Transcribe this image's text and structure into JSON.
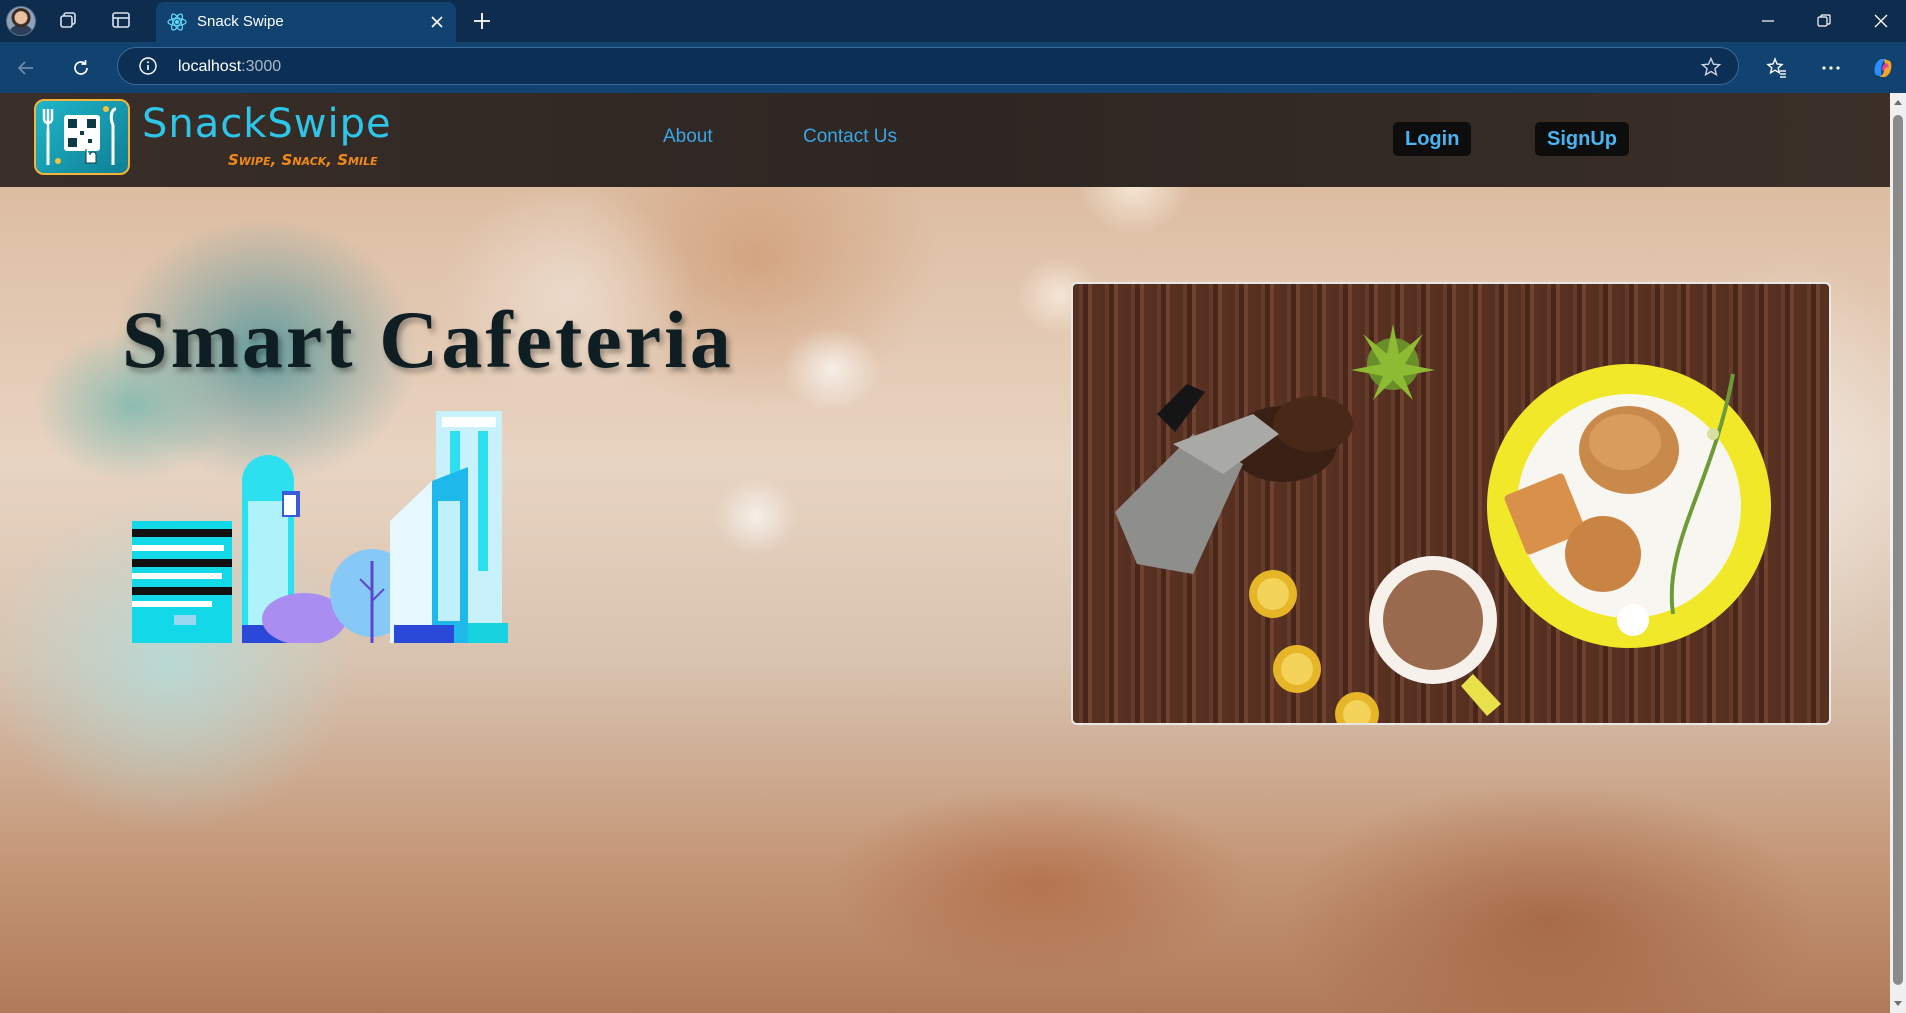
{
  "browser": {
    "tab_title": "Snack Swipe",
    "url_host": "localhost",
    "url_port": ":3000"
  },
  "header": {
    "logo_text": "SnackSwipe",
    "logo_tagline": "Swipe, Snack, Smile",
    "nav": [
      "About",
      "Contact Us"
    ],
    "login_label": "Login",
    "signup_label": "SignUp"
  },
  "hero": {
    "title": "Smart Cafeteria"
  },
  "colors": {
    "browser_frame": "#0e2c4d",
    "tab_active": "#124270",
    "header_bg": "#2d2622",
    "nav_link": "#3aa6e6",
    "auth_button_bg": "#0d0d0d",
    "auth_button_text": "#4bb3f0",
    "hero_title": "#0f1e22"
  },
  "icons": {
    "tabbar": [
      "profile-avatar",
      "workspaces-icon",
      "tab-actions-icon",
      "react-favicon-icon",
      "close-tab-icon",
      "new-tab-icon"
    ],
    "window": [
      "minimize-icon",
      "restore-icon",
      "close-window-icon"
    ],
    "addressbar": [
      "back-icon",
      "reload-icon",
      "site-info-icon",
      "favorite-star-icon",
      "favorites-icon",
      "more-icon",
      "copilot-icon"
    ]
  }
}
